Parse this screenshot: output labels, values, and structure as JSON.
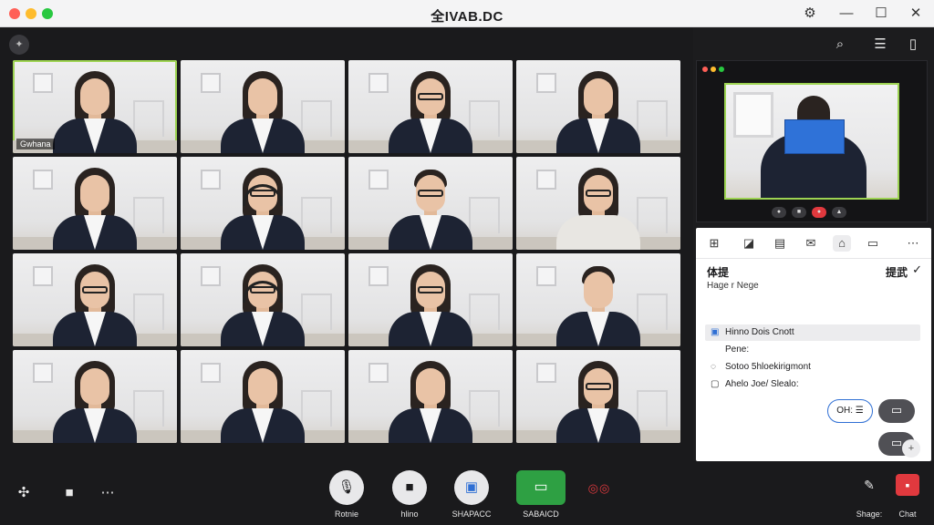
{
  "window": {
    "title": "全IVAB.DC"
  },
  "title_bar": {
    "icons": [
      "gear-icon",
      "minimize-icon",
      "maximize-icon",
      "close-icon"
    ]
  },
  "participants": [
    {
      "name": "Gwhana",
      "active": true
    },
    {
      "name": ""
    },
    {
      "name": ""
    },
    {
      "name": ""
    },
    {
      "name": ""
    },
    {
      "name": ""
    },
    {
      "name": ""
    },
    {
      "name": ""
    },
    {
      "name": ""
    },
    {
      "name": ""
    },
    {
      "name": ""
    },
    {
      "name": ""
    },
    {
      "name": ""
    },
    {
      "name": ""
    },
    {
      "name": ""
    },
    {
      "name": ""
    }
  ],
  "right_panel": {
    "top_icons": [
      "search-icon",
      "list-icon",
      "phone-icon"
    ],
    "preview": {
      "screen_label": ""
    },
    "toolbar_icons": [
      "grid-icon",
      "chart-icon",
      "layout-icon",
      "chat-icon",
      "home-icon",
      "screen-icon",
      "more-icon"
    ],
    "section_title": "体提",
    "section_right": "提武",
    "section_subtitle": "Hage r  Nege",
    "items": [
      {
        "label": "Hinno Dois Cnott",
        "selected": true
      },
      {
        "label": "Pene:"
      },
      {
        "label": "Sotoo 5hloekirigmont"
      },
      {
        "label": "Ahelo Joe/ Slealo:"
      }
    ],
    "ok_label": "OH: ☰"
  },
  "controls": {
    "mute_label": "Rotnie",
    "video_label": "hlino",
    "share_label": "SHAPACC",
    "screen_label": "SABAICD",
    "share_right_label": "Shage:",
    "chat_label": "Chat"
  }
}
